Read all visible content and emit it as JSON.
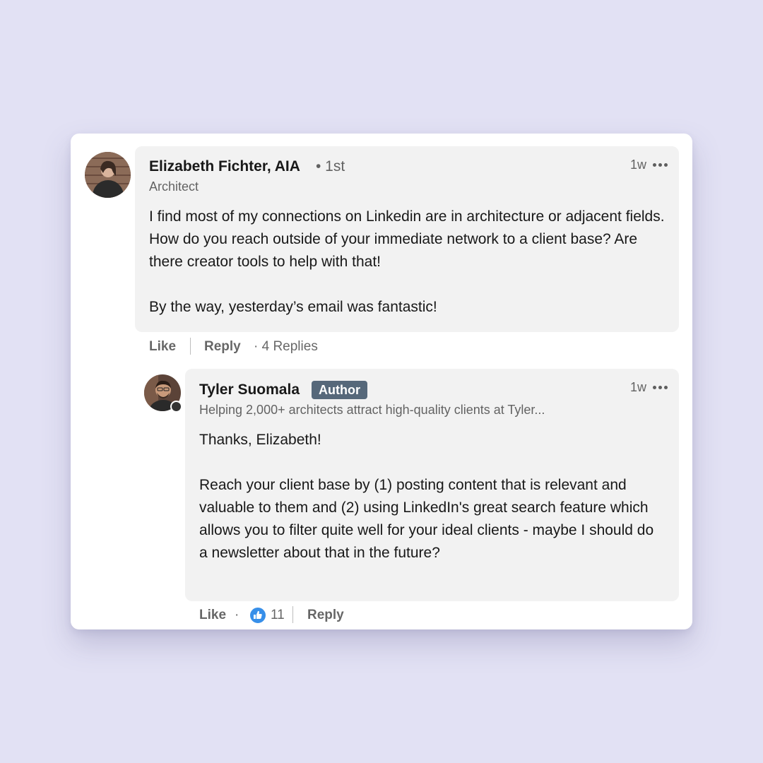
{
  "comment": {
    "author_name": "Elizabeth Fichter, AIA",
    "connection_degree": "• 1st",
    "headline": "Architect",
    "timestamp": "1w",
    "paragraph_1": "I find most of my connections on Linkedin are in architecture or adjacent fields. How do you reach outside of your immediate network to a client base? Are there creator tools to help with that!",
    "paragraph_2": "By the way, yesterday’s email was fantastic!",
    "like_label": "Like",
    "reply_label": "Reply",
    "replies_count": "· 4 Replies"
  },
  "reply": {
    "author_name": "Tyler Suomala",
    "author_badge": "Author",
    "headline": "Helping 2,000+ architects attract high-quality clients at Tyler...",
    "timestamp": "1w",
    "paragraph_1": "Thanks, Elizabeth!",
    "paragraph_2": "Reach your client base by (1) posting content that is relevant and valuable to them and (2) using LinkedIn's great search feature which allows you to filter quite well for your ideal clients - maybe I should do a newsletter about that in the future?",
    "like_label": "Like",
    "dot_separator": "·",
    "reaction_icon": "thumbs-up-icon",
    "reaction_count": "11",
    "reply_label": "Reply"
  },
  "colors": {
    "background": "#e2e1f4",
    "bubble": "#f2f2f2",
    "badge": "#56687a",
    "like_reaction": "#378fe9"
  }
}
